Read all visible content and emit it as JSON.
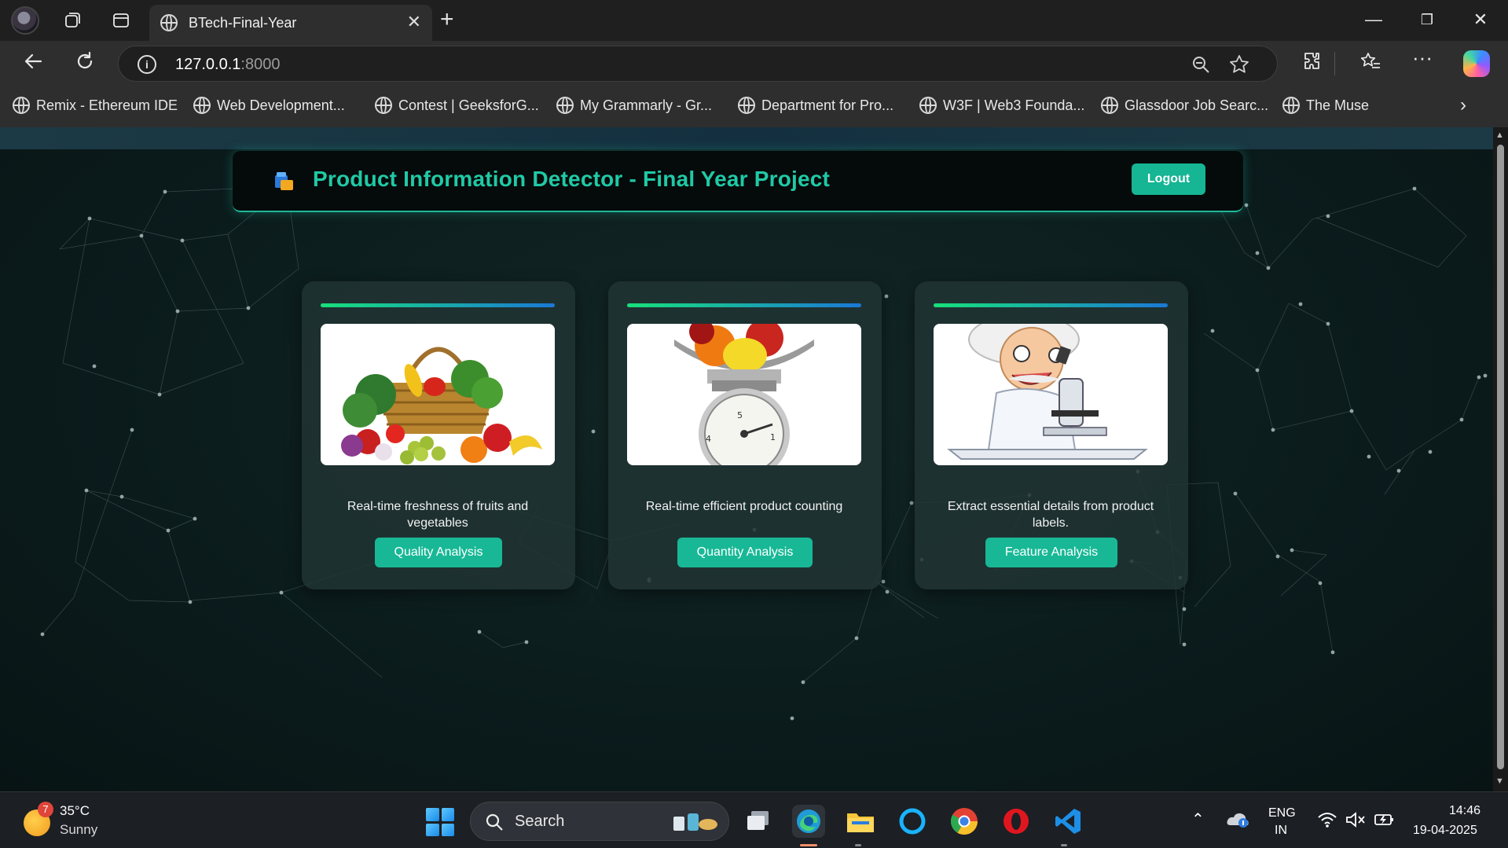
{
  "browser": {
    "tab_title": "BTech-Final-Year",
    "url_host": "127.0.0.1",
    "url_port": ":8000",
    "bookmarks": [
      "Remix - Ethereum IDE",
      "Web Development...",
      "Contest | GeeksforG...",
      "My Grammarly - Gr...",
      "Department for Pro...",
      "W3F | Web3 Founda...",
      "Glassdoor Job Searc...",
      "The Muse"
    ]
  },
  "app": {
    "title": "Product Information Detector - Final Year Project",
    "logout_label": "Logout",
    "cards": [
      {
        "description": "Real-time freshness of fruits and vegetables",
        "button": "Quality Analysis",
        "image": "fruit-basket"
      },
      {
        "description": "Real-time efficient product counting",
        "button": "Quantity Analysis",
        "image": "kitchen-scale"
      },
      {
        "description": "Extract essential details from product labels.",
        "button": "Feature Analysis",
        "image": "scientist-microscope"
      }
    ],
    "colors": {
      "accent": "#20c9a6",
      "button": "#18b896",
      "background": "#0b1b1c"
    }
  },
  "taskbar": {
    "weather_badge": "7",
    "temperature": "35°C",
    "condition": "Sunny",
    "search_label": "Search",
    "lang_1": "ENG",
    "lang_2": "IN",
    "time": "14:46",
    "date": "19-04-2025"
  }
}
